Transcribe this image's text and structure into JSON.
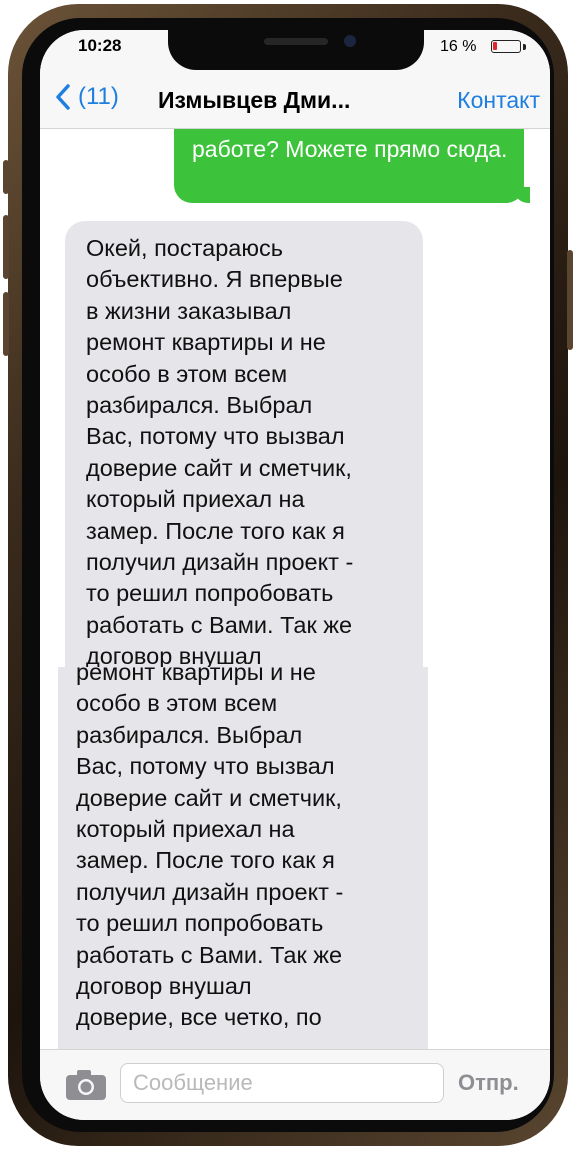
{
  "status_bar": {
    "time": "10:28",
    "battery_percent": "16 %",
    "battery_level": 0.16
  },
  "nav": {
    "back_label": "(11)",
    "title": "Измывцев Дми...",
    "contact_label": "Контакт"
  },
  "messages": {
    "outgoing_partial": "работе? Можете прямо сюда.",
    "incoming_first": "Окей, постараюсь\nобъективно. Я впервые\nв жизни заказывал\nремонт квартиры и не\nособо в этом всем\nразбирался. Выбрал\nВас, потому что вызвал\nдоверие сайт и сметчик,\nкоторый приехал на\nзамер. После того как я\nполучил дизайн проект -\nто решил попробовать\nработать с Вами. Так же\nдоговор внушал",
    "incoming_second": "ремонт квартиры и не\nособо в этом всем\nразбирался. Выбрал\nВас, потому что вызвал\nдоверие сайт и сметчик,\nкоторый приехал на\nзамер. После того как я\nполучил дизайн проект -\nто решил попробовать\nработать с Вами. Так же\nдоговор внушал\nдоверие, все четко, по"
  },
  "input": {
    "placeholder": "Сообщение",
    "value": "",
    "send_label": "Отпр."
  },
  "colors": {
    "accent": "#1f7fe0",
    "outgoing_bubble": "#3dc33b",
    "incoming_bubble": "#e5e5ea",
    "battery_low": "#e0262b"
  },
  "icons": [
    "chevron-left-icon",
    "camera-icon",
    "battery-icon"
  ]
}
